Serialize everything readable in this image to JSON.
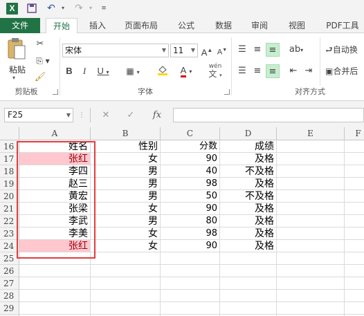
{
  "quick_access": {
    "app_icon": "excel-logo-icon",
    "app_letter": "X"
  },
  "tabs": [
    "文件",
    "开始",
    "插入",
    "页面布局",
    "公式",
    "数据",
    "审阅",
    "视图",
    "PDF工具"
  ],
  "ribbon": {
    "clipboard": {
      "paste_label": "粘贴",
      "group_label": "剪贴板"
    },
    "font": {
      "font_name": "宋体",
      "font_size": "11",
      "phonetic_label": "wén",
      "group_label": "字体"
    },
    "alignment": {
      "wrap_label": "自动换",
      "merge_label": "合并后",
      "group_label": "对齐方式"
    }
  },
  "formula_bar": {
    "name_box": "F25",
    "fx_label": "fx",
    "formula_value": ""
  },
  "grid": {
    "columns": [
      "A",
      "B",
      "C",
      "D",
      "E",
      "F"
    ],
    "rows": [
      {
        "row": "16",
        "cells": [
          "姓名",
          "性别",
          "分数",
          "成绩"
        ]
      },
      {
        "row": "17",
        "cells": [
          "张红",
          "女",
          "90",
          "及格"
        ]
      },
      {
        "row": "18",
        "cells": [
          "李四",
          "男",
          "40",
          "不及格"
        ]
      },
      {
        "row": "19",
        "cells": [
          "赵三",
          "男",
          "98",
          "及格"
        ]
      },
      {
        "row": "20",
        "cells": [
          "黄宏",
          "男",
          "50",
          "不及格"
        ]
      },
      {
        "row": "21",
        "cells": [
          "张梁",
          "女",
          "90",
          "及格"
        ]
      },
      {
        "row": "22",
        "cells": [
          "李武",
          "男",
          "80",
          "及格"
        ]
      },
      {
        "row": "23",
        "cells": [
          "李美",
          "女",
          "98",
          "及格"
        ]
      },
      {
        "row": "24",
        "cells": [
          "张红",
          "女",
          "90",
          "及格"
        ]
      },
      {
        "row": "25",
        "cells": [
          "",
          "",
          "",
          ""
        ]
      },
      {
        "row": "26",
        "cells": [
          "",
          "",
          "",
          ""
        ]
      },
      {
        "row": "27",
        "cells": [
          "",
          "",
          "",
          ""
        ]
      },
      {
        "row": "28",
        "cells": [
          "",
          "",
          "",
          ""
        ]
      },
      {
        "row": "29",
        "cells": [
          "",
          "",
          "",
          ""
        ]
      },
      {
        "row": "30",
        "cells": [
          "",
          "",
          "",
          ""
        ]
      }
    ],
    "duplicate_highlight_color": "#ffc7ce",
    "duplicate_text_color": "#9c0006",
    "selection_border_color": "#e23c3c"
  }
}
